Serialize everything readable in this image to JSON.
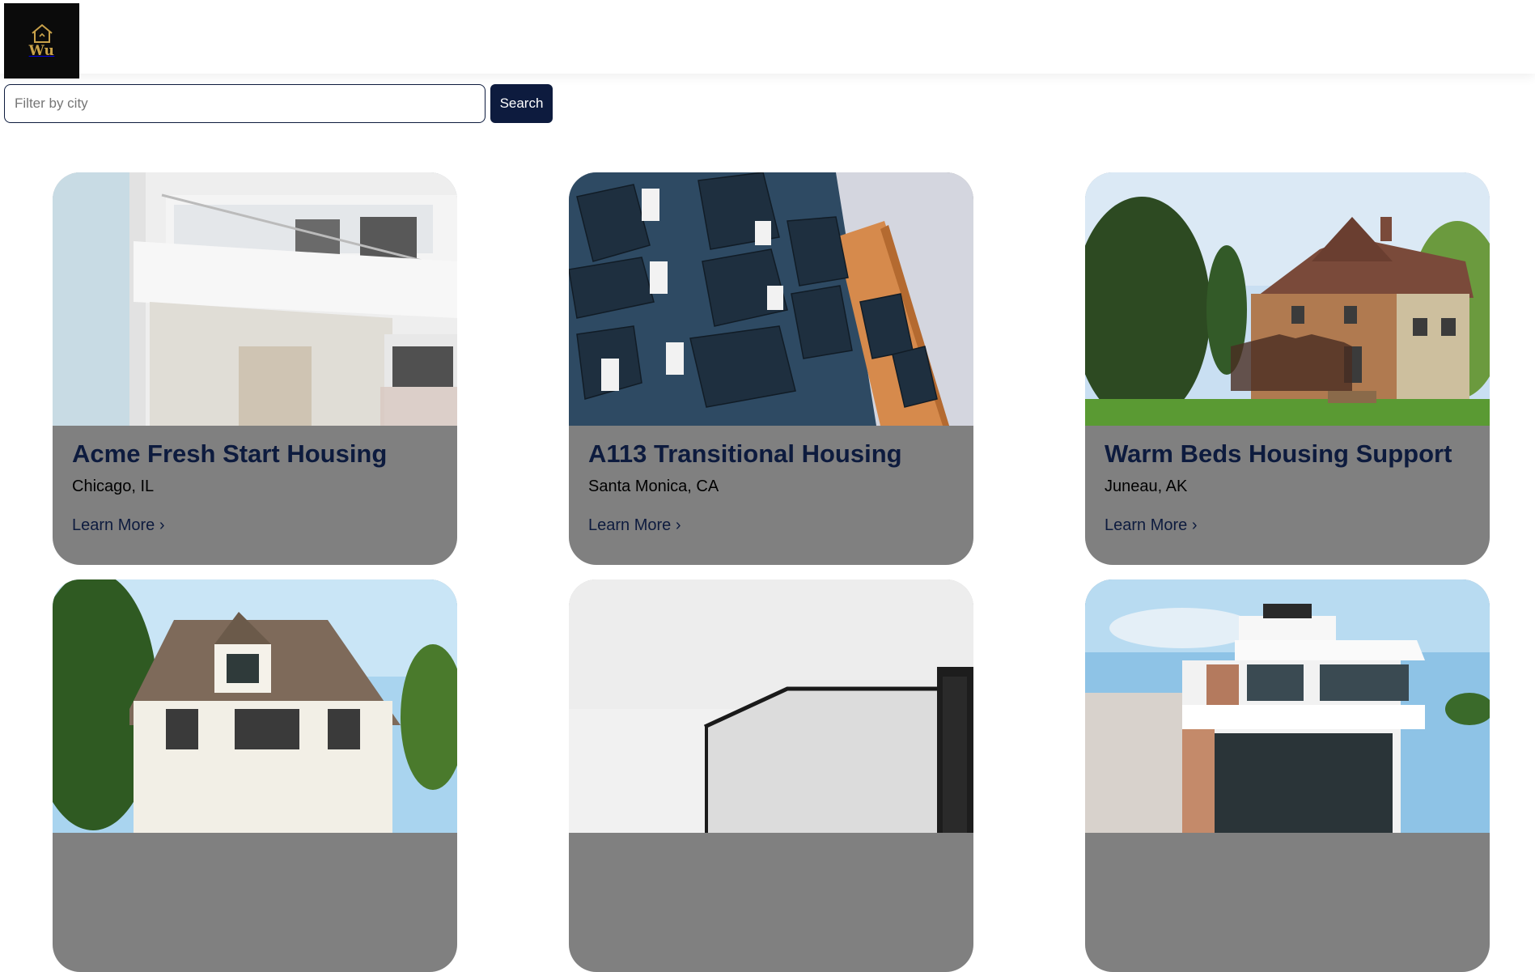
{
  "brand": {
    "logo_text": "Wu",
    "logo_color": "#c9a24a"
  },
  "filter": {
    "placeholder": "Filter by city",
    "value": "",
    "button_label": "Search"
  },
  "colors": {
    "navy": "#0d1b3e",
    "card_bg": "#808080"
  },
  "listings": [
    {
      "title": "Acme Fresh Start Housing",
      "location": "Chicago, IL",
      "link": "Learn More ›",
      "image": "white-modern-apartment-balconies"
    },
    {
      "title": "A113 Transitional Housing",
      "location": "Santa Monica, CA",
      "link": "Learn More ›",
      "image": "blue-orange-apartment-building"
    },
    {
      "title": "Warm Beds Housing Support",
      "location": "Juneau, AK",
      "link": "Learn More ›",
      "image": "victorian-house-with-trees"
    },
    {
      "title": "",
      "location": "",
      "link": "",
      "image": "white-suburban-house"
    },
    {
      "title": "",
      "location": "",
      "link": "",
      "image": "minimal-gray-building"
    },
    {
      "title": "",
      "location": "",
      "link": "",
      "image": "modern-luxury-villa"
    }
  ]
}
